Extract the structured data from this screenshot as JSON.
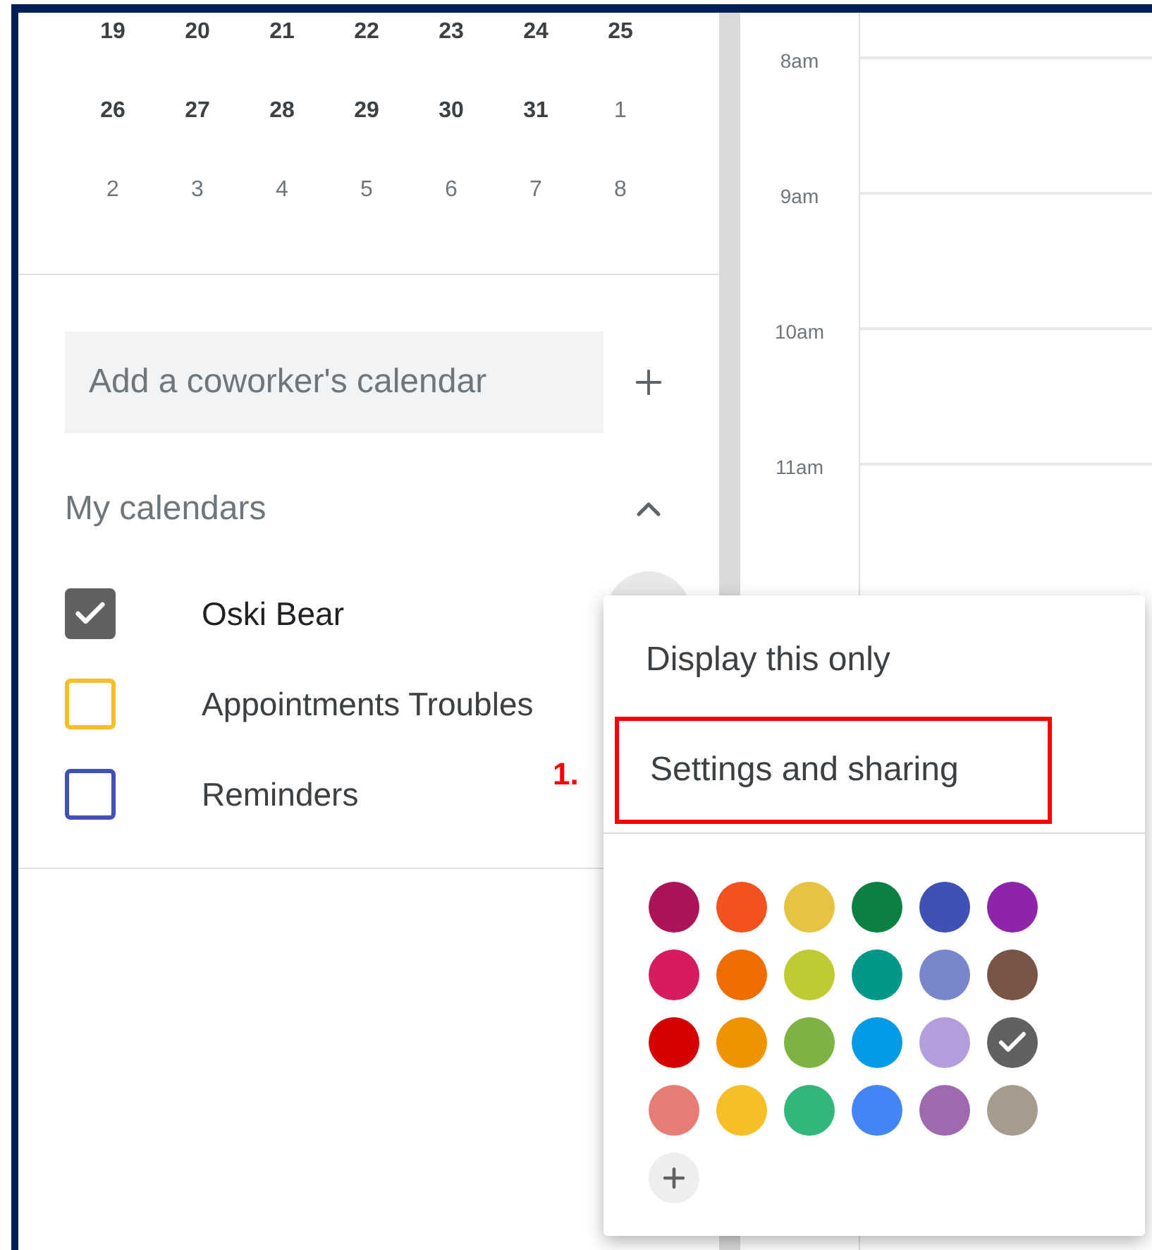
{
  "mini_calendar": {
    "weeks": [
      [
        {
          "label": "19",
          "muted": false
        },
        {
          "label": "20",
          "muted": false
        },
        {
          "label": "21",
          "muted": false
        },
        {
          "label": "22",
          "muted": false
        },
        {
          "label": "23",
          "muted": false
        },
        {
          "label": "24",
          "muted": false
        },
        {
          "label": "25",
          "muted": false
        }
      ],
      [
        {
          "label": "26",
          "muted": false
        },
        {
          "label": "27",
          "muted": false
        },
        {
          "label": "28",
          "muted": false
        },
        {
          "label": "29",
          "muted": false
        },
        {
          "label": "30",
          "muted": false
        },
        {
          "label": "31",
          "muted": false
        },
        {
          "label": "1",
          "muted": true
        }
      ],
      [
        {
          "label": "2",
          "muted": true
        },
        {
          "label": "3",
          "muted": true
        },
        {
          "label": "4",
          "muted": true
        },
        {
          "label": "5",
          "muted": true
        },
        {
          "label": "6",
          "muted": true
        },
        {
          "label": "7",
          "muted": true
        },
        {
          "label": "8",
          "muted": true
        }
      ]
    ]
  },
  "add_calendar": {
    "placeholder": "Add a coworker's calendar"
  },
  "my_calendars": {
    "title": "My calendars",
    "expanded": true,
    "items": [
      {
        "name": "Oski Bear",
        "checked": true,
        "color": "#616161"
      },
      {
        "name": "Appointments Troubles",
        "checked": false,
        "color": "#f6bf26"
      },
      {
        "name": "Reminders",
        "checked": false,
        "color": "#3f51b5"
      }
    ]
  },
  "time_labels": [
    "8am",
    "9am",
    "10am",
    "11am"
  ],
  "menu": {
    "items": [
      {
        "label": "Display this only",
        "highlighted": false
      },
      {
        "label": "Settings and sharing",
        "highlighted": true
      }
    ],
    "colors": [
      {
        "color": "#ad1457",
        "selected": false
      },
      {
        "color": "#f4511e",
        "selected": false
      },
      {
        "color": "#e4c441",
        "selected": false
      },
      {
        "color": "#0b8043",
        "selected": false
      },
      {
        "color": "#3f51b5",
        "selected": false
      },
      {
        "color": "#8e24aa",
        "selected": false
      },
      {
        "color": "#d81b60",
        "selected": false
      },
      {
        "color": "#ef6c00",
        "selected": false
      },
      {
        "color": "#c0ca33",
        "selected": false
      },
      {
        "color": "#009688",
        "selected": false
      },
      {
        "color": "#7986cb",
        "selected": false
      },
      {
        "color": "#795548",
        "selected": false
      },
      {
        "color": "#d50000",
        "selected": false
      },
      {
        "color": "#f09300",
        "selected": false
      },
      {
        "color": "#7cb342",
        "selected": false
      },
      {
        "color": "#039be5",
        "selected": false
      },
      {
        "color": "#b39ddb",
        "selected": false
      },
      {
        "color": "#616161",
        "selected": true
      },
      {
        "color": "#e67c73",
        "selected": false
      },
      {
        "color": "#f6bf26",
        "selected": false
      },
      {
        "color": "#33b679",
        "selected": false
      },
      {
        "color": "#4285f4",
        "selected": false
      },
      {
        "color": "#9e69af",
        "selected": false
      },
      {
        "color": "#a79b8e",
        "selected": false
      }
    ]
  },
  "annotation": "1."
}
